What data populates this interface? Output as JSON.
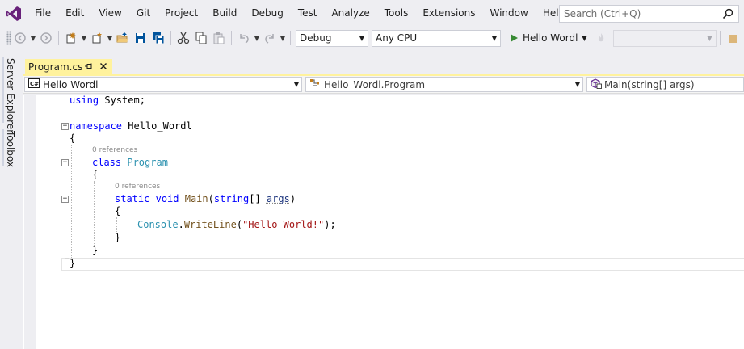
{
  "app": {
    "logo_icon": "visual-studio-logo-icon",
    "accent_color": "#68217a"
  },
  "menu": {
    "items": [
      "File",
      "Edit",
      "View",
      "Git",
      "Project",
      "Build",
      "Debug",
      "Test",
      "Analyze",
      "Tools",
      "Extensions",
      "Window",
      "Help"
    ]
  },
  "search": {
    "placeholder": "Search (Ctrl+Q)"
  },
  "toolbar": {
    "configuration": "Debug",
    "platform": "Any CPU",
    "run_label": "Hello Wordl",
    "run_color": "#388a34"
  },
  "side_tabs": {
    "server_explorer": "Server Explorer",
    "toolbox": "Toolbox"
  },
  "document_tab": {
    "title": "Program.cs",
    "color": "#fff29d"
  },
  "navbar": {
    "project": "Hello Wordl",
    "type": "Hello_Wordl.Program",
    "member": "Main(string[] args)"
  },
  "code": {
    "line1_kw": "using",
    "line1_rest": " System;",
    "line3_kw": "namespace",
    "line3_rest": " Hello_Wordl",
    "open_brace": "{",
    "close_brace": "}",
    "refs": "0 references",
    "class_kw": "class",
    "class_name": "Program",
    "static_kw": "static",
    "void_kw": "void",
    "method_name": "Main",
    "string_kw": "string",
    "args_param": "args",
    "console_type": "Console",
    "writeline": "WriteLine",
    "string_literal": "\"Hello World!\"",
    "paren_open": "(",
    "paren_close": ")",
    "brackets": "[] ",
    "dot": ".",
    "semicolon_close": ");"
  }
}
